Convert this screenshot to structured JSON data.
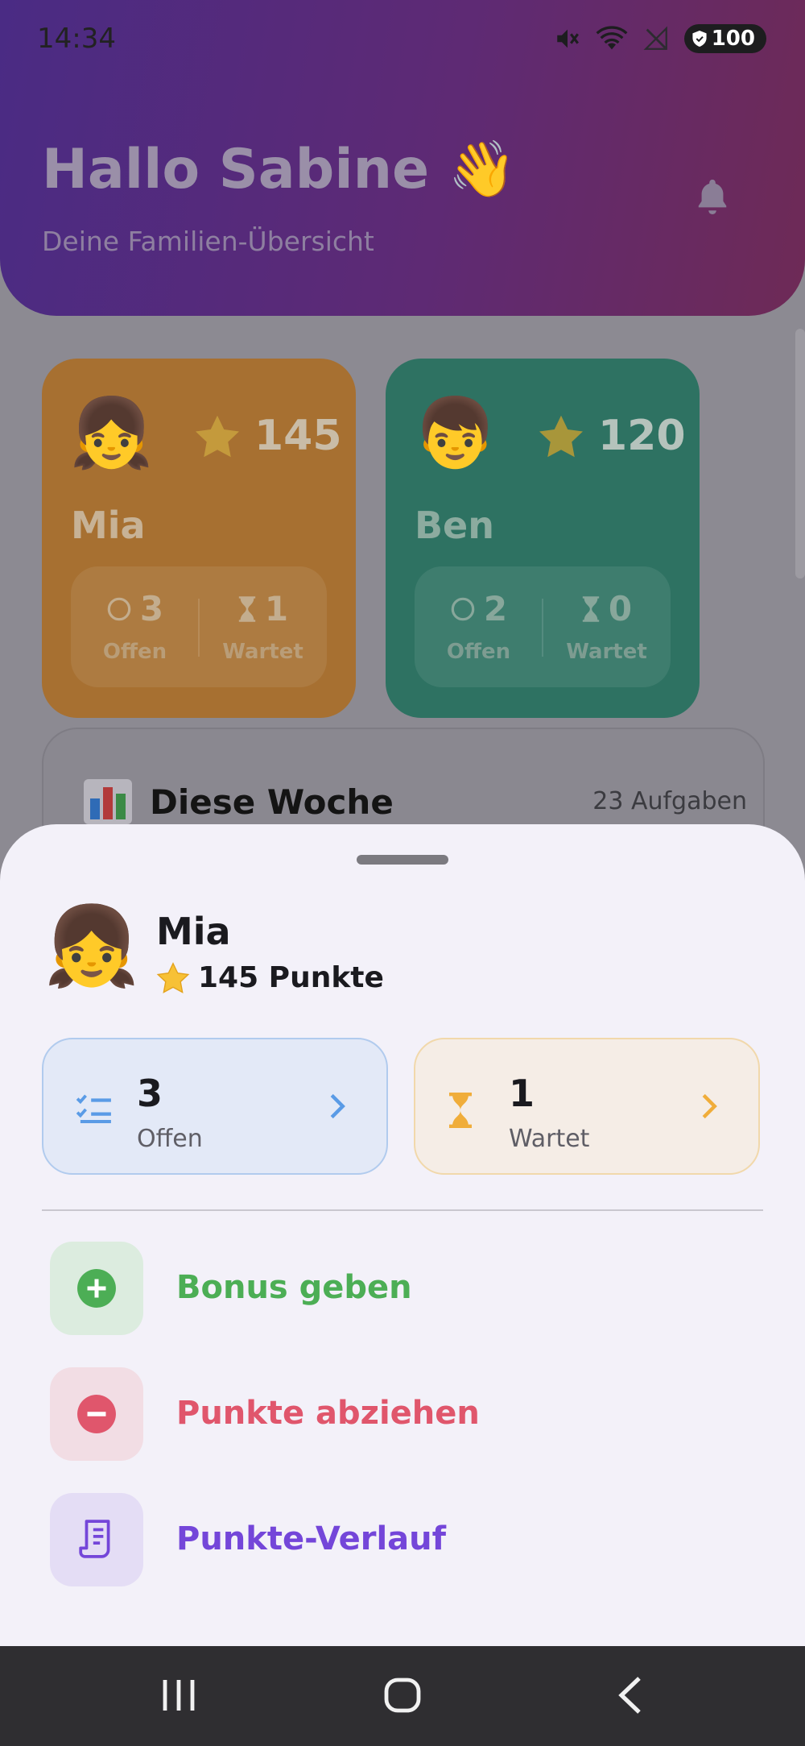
{
  "status_bar": {
    "time": "14:34",
    "battery": "100",
    "icons": [
      "mute-icon",
      "wifi-icon",
      "no-signal-icon",
      "battery-icon"
    ]
  },
  "header": {
    "greeting": "Hallo Sabine 👋",
    "subtitle": "Deine Familien-Übersicht",
    "bell_icon": "bell-icon"
  },
  "children": [
    {
      "name": "Mia",
      "avatar": "👧",
      "points": "145",
      "open_count": "3",
      "open_label": "Offen",
      "waiting_count": "1",
      "waiting_label": "Wartet",
      "card_color": "#a77031"
    },
    {
      "name": "Ben",
      "avatar": "👦",
      "points": "120",
      "open_count": "2",
      "open_label": "Offen",
      "waiting_count": "0",
      "waiting_label": "Wartet",
      "card_color": "#2e7262"
    }
  ],
  "week_summary": {
    "title": "Diese Woche",
    "count": "23 Aufgaben",
    "icon": "bar-chart-icon"
  },
  "sheet": {
    "avatar": "👧",
    "name": "Mia",
    "points_label": "145 Punkte",
    "open_tile": {
      "value": "3",
      "label": "Offen",
      "icon": "checklist-icon",
      "accent": "#5a9be6"
    },
    "waiting_tile": {
      "value": "1",
      "label": "Wartet",
      "icon": "hourglass-icon",
      "accent": "#f0ad3a"
    },
    "actions": [
      {
        "label": "Bonus geben",
        "icon": "plus-circle-icon",
        "color": "#4cae55"
      },
      {
        "label": "Punkte abziehen",
        "icon": "minus-circle-icon",
        "color": "#e0566c"
      },
      {
        "label": "Punkte-Verlauf",
        "icon": "receipt-icon",
        "color": "#7446d9"
      }
    ]
  },
  "nav_bar": {
    "buttons": [
      "recent-apps-icon",
      "home-icon",
      "back-icon"
    ]
  }
}
